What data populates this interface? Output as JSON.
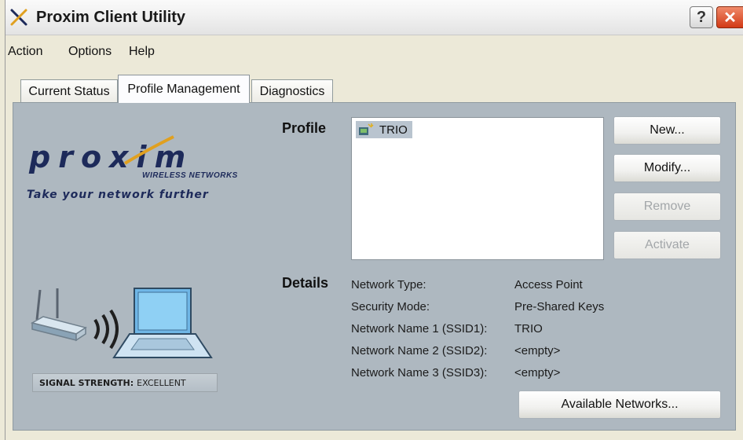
{
  "window": {
    "title": "Proxim Client Utility"
  },
  "titlebar": {
    "help_label": "?",
    "close_label": "✕"
  },
  "menu": {
    "items": [
      "Action",
      "Options",
      "Help"
    ]
  },
  "tabs": [
    {
      "label": "Current Status"
    },
    {
      "label": "Profile Management"
    },
    {
      "label": "Diagnostics"
    }
  ],
  "branding": {
    "logo_text": "proxim",
    "logo_subtitle": "WIRELESS NETWORKS",
    "tagline": "Take your network further"
  },
  "signal": {
    "label": "SIGNAL STRENGTH:",
    "value": "EXCELLENT"
  },
  "profile": {
    "label": "Profile",
    "items": [
      {
        "name": "TRIO"
      }
    ]
  },
  "buttons": {
    "new": "New...",
    "modify": "Modify...",
    "remove": "Remove",
    "activate": "Activate",
    "available_networks": "Available Networks..."
  },
  "details": {
    "label": "Details",
    "rows": [
      {
        "key": "Network Type:",
        "value": "Access Point"
      },
      {
        "key": "Security Mode:",
        "value": "Pre-Shared Keys"
      },
      {
        "key": "Network Name 1 (SSID1):",
        "value": "TRIO"
      },
      {
        "key": "Network Name 2 (SSID2):",
        "value": "<empty>"
      },
      {
        "key": "Network Name 3 (SSID3):",
        "value": "<empty>"
      }
    ]
  }
}
